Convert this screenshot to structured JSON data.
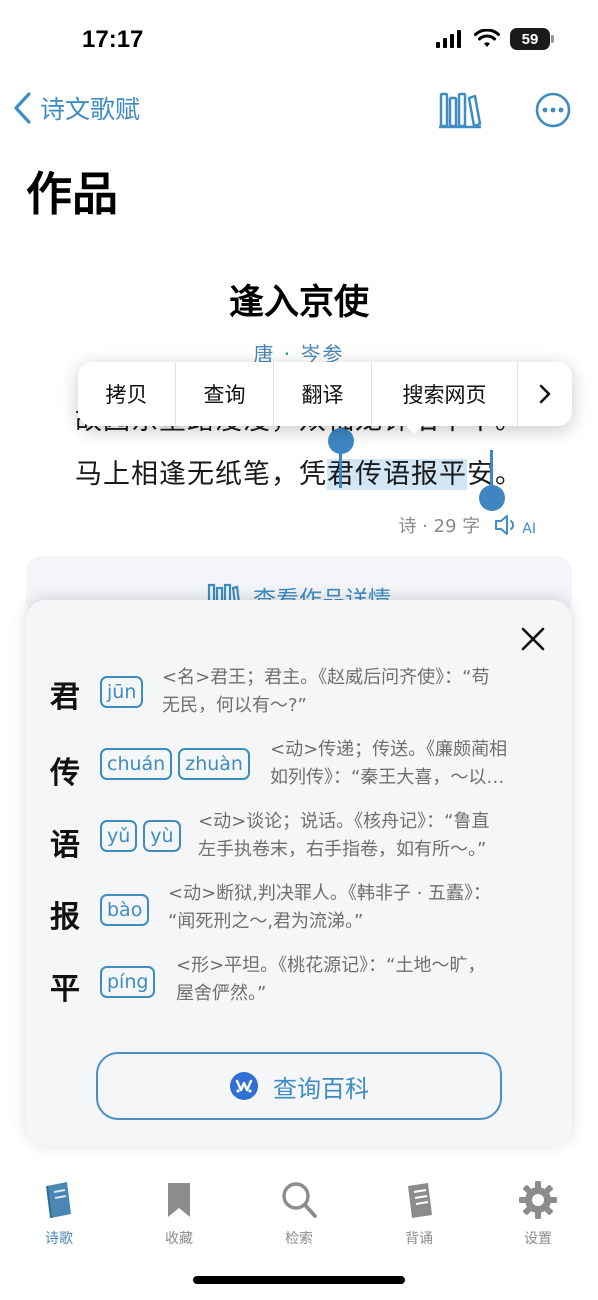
{
  "status": {
    "time": "17:17",
    "battery": "59"
  },
  "nav": {
    "back_label": "诗文歌赋"
  },
  "page": {
    "title": "作品"
  },
  "poem": {
    "title": "逢入京使",
    "author": "唐 · 岑参",
    "line1": "故园东望路漫漫，双袖龙钟泪不干。",
    "line2_pre": "马上相逢无纸笔，凭",
    "line2_sel": "君传语报平",
    "line2_post": "安。",
    "meta": "诗 · 29 字",
    "ai_label": "AI"
  },
  "context_menu": {
    "items": [
      "拷贝",
      "查询",
      "翻译",
      "搜索网页"
    ]
  },
  "details": {
    "label": "查看作品详情"
  },
  "dictionary": {
    "entries": [
      {
        "char": "君",
        "pinyin": [
          "jūn"
        ],
        "def": [
          "<名>君王；君主。《赵威后问齐使》：“苟",
          "无民，何以有～?”"
        ]
      },
      {
        "char": "传",
        "pinyin": [
          "chuán",
          "zhuàn"
        ],
        "def": [
          "<动>传递；传送。《廉颇蔺相",
          "如列传》：“秦王大喜，～以…"
        ]
      },
      {
        "char": "语",
        "pinyin": [
          "yǔ",
          "yù"
        ],
        "def": [
          "<动>谈论；说话。《核舟记》：“鲁直",
          "左手执卷末，右手指卷，如有所～。”"
        ]
      },
      {
        "char": "报",
        "pinyin": [
          "bào"
        ],
        "def": [
          "<动>断狱,判决罪人。《韩非子 · 五蠹》：",
          "“闻死刑之～,君为流涕。”"
        ]
      },
      {
        "char": "平",
        "pinyin": [
          "píng"
        ],
        "def": [
          "<形>平坦。《桃花源记》：“土地～旷，",
          "屋舍俨然。”"
        ]
      }
    ],
    "wiki_button": "查询百科"
  },
  "tabs": [
    {
      "label": "诗歌",
      "icon": "poetry-book-icon"
    },
    {
      "label": "收藏",
      "icon": "bookmark-icon"
    },
    {
      "label": "检索",
      "icon": "search-icon"
    },
    {
      "label": "背诵",
      "icon": "recite-book-icon"
    },
    {
      "label": "设置",
      "icon": "gear-icon"
    }
  ],
  "colors": {
    "accent": "#3f8cc2",
    "selection": "#d3e6f6",
    "popup_bg": "#f5f6f8"
  }
}
